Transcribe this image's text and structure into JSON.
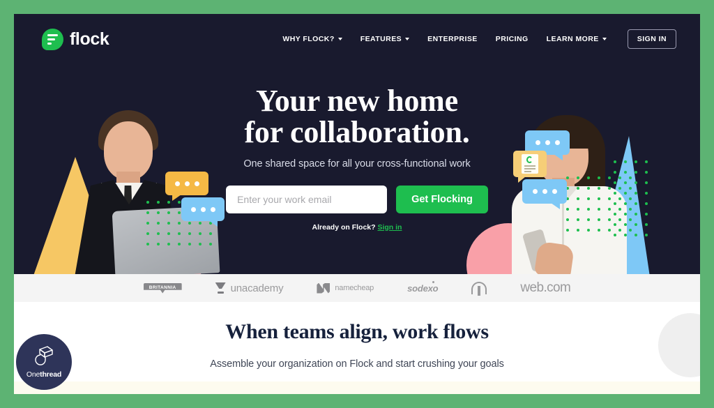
{
  "theme": {
    "page_background": "#5DB373",
    "hero_background": "#191A2E",
    "accent_green": "#1EBE4F",
    "logo_strip_background": "#F4F4F4",
    "cream_band": "#FDFBEF",
    "badge_navy": "#2E3459"
  },
  "nav": {
    "brand": "flock",
    "brand_icon": "flock-speech-bubble-logo",
    "links": [
      {
        "label": "WHY FLOCK?",
        "has_dropdown": true
      },
      {
        "label": "FEATURES",
        "has_dropdown": true
      },
      {
        "label": "ENTERPRISE",
        "has_dropdown": false
      },
      {
        "label": "PRICING",
        "has_dropdown": false
      },
      {
        "label": "LEARN MORE",
        "has_dropdown": true
      }
    ],
    "sign_in_label": "SIGN IN"
  },
  "hero": {
    "headline_line1": "Your new home",
    "headline_line2": "for collaboration.",
    "subheading": "One shared space for all your cross-functional work",
    "email_placeholder": "Enter your work email",
    "email_value": "",
    "cta_label": "Get Flocking",
    "already_text": "Already on Flock?",
    "already_link": "Sign in"
  },
  "logo_strip": {
    "logos": [
      {
        "name": "britannia",
        "label": "BRITANNIA",
        "icon": "britannia-shield-icon"
      },
      {
        "name": "unacademy",
        "label": "unacademy",
        "icon": "trophy-icon"
      },
      {
        "name": "namecheap",
        "label": "namecheap",
        "icon": "namecheap-n-icon"
      },
      {
        "name": "sodexo",
        "label": "sodexo",
        "icon": ""
      },
      {
        "name": "mcdonalds",
        "label": "",
        "icon": "mcdonalds-arch-icon"
      },
      {
        "name": "webcom",
        "label": "web.com",
        "icon": ""
      }
    ]
  },
  "bottom_section": {
    "title": "When teams align, work flows",
    "subtitle": "Assemble your organization on Flock and start crushing your goals"
  },
  "watermark": {
    "name_light": "One",
    "name_bold": "thread",
    "icon": "onethread-isometric-icon"
  }
}
